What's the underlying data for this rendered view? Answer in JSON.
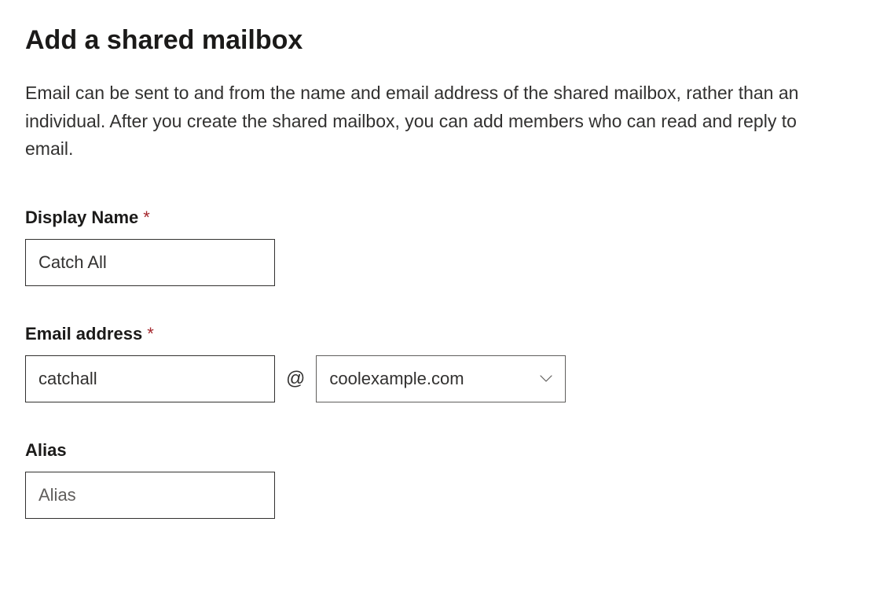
{
  "title": "Add a shared mailbox",
  "description": "Email can be sent to and from the name and email address of the shared mailbox, rather than an individual. After you create the shared mailbox, you can add members who can read and reply to email.",
  "fields": {
    "displayName": {
      "label": "Display Name",
      "required": true,
      "value": "Catch All"
    },
    "emailAddress": {
      "label": "Email address",
      "required": true,
      "localPart": "catchall",
      "atSymbol": "@",
      "domain": "coolexample.com"
    },
    "alias": {
      "label": "Alias",
      "required": false,
      "value": "",
      "placeholder": "Alias"
    }
  },
  "requiredMarker": "*"
}
